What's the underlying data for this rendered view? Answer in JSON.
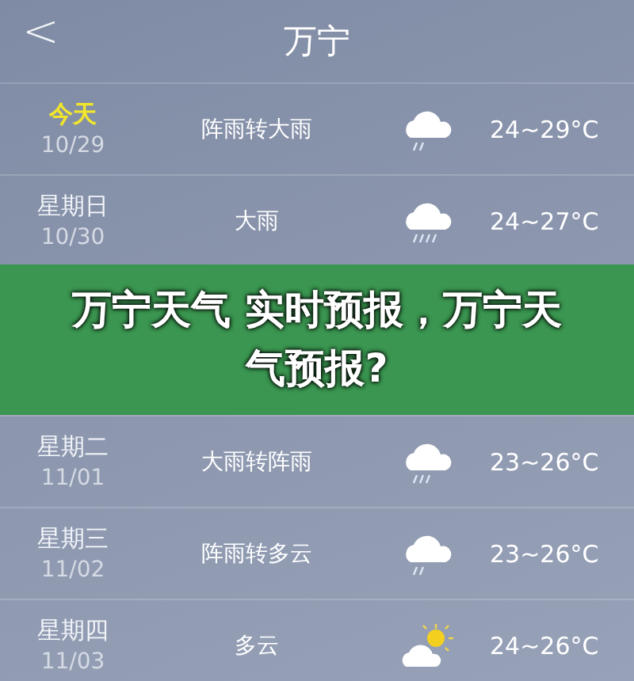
{
  "header": {
    "back": "<",
    "title": "万宁"
  },
  "forecast": [
    {
      "day": "今天",
      "today": true,
      "date": "10/29",
      "weather": "阵雨转大雨",
      "kind": "shower",
      "temp": "24~29°C"
    },
    {
      "day": "星期日",
      "today": false,
      "date": "10/30",
      "weather": "大雨",
      "kind": "heavy_rain",
      "temp": "24~27°C"
    },
    {
      "day": "星期二",
      "today": false,
      "date": "11/01",
      "weather": "大雨转阵雨",
      "kind": "rain",
      "temp": "23~26°C"
    },
    {
      "day": "星期三",
      "today": false,
      "date": "11/02",
      "weather": "阵雨转多云",
      "kind": "shower",
      "temp": "23~26°C"
    },
    {
      "day": "星期四",
      "today": false,
      "date": "11/03",
      "weather": "多云",
      "kind": "partly_cloudy",
      "temp": "24~26°C"
    }
  ],
  "banner": {
    "headline": "万宁天气 实时预报，万宁天气预报?"
  }
}
